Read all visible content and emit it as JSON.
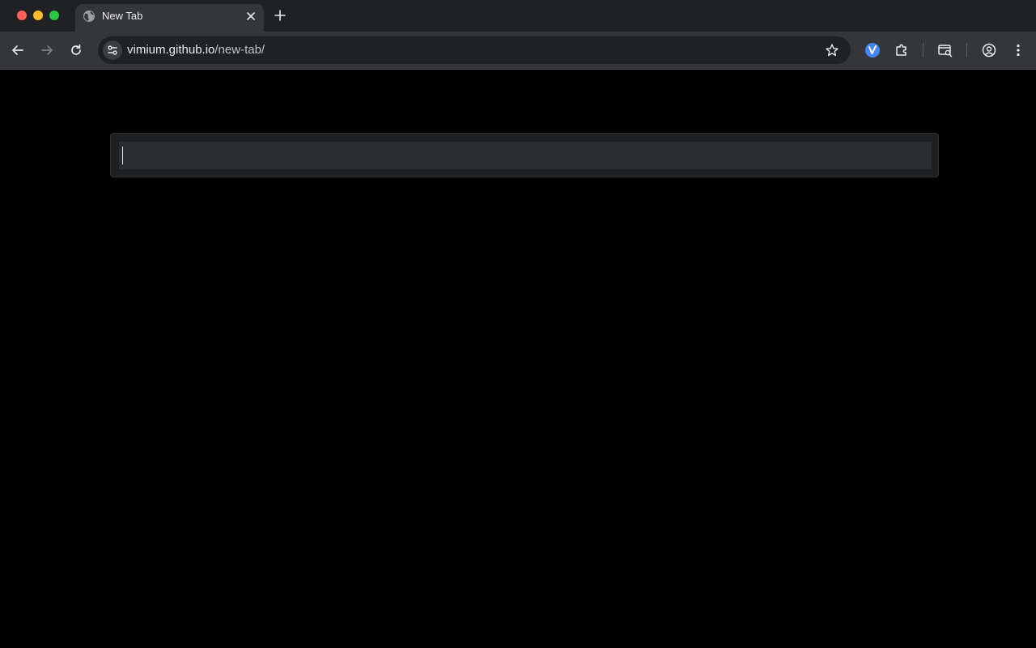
{
  "browser": {
    "tab": {
      "title": "New Tab"
    },
    "omnibox": {
      "url_host": "vimium.github.io",
      "url_path": "/new-tab/"
    },
    "icons": {
      "favicon": "globe-icon",
      "tab_close": "close-icon",
      "new_tab": "plus-icon",
      "back": "arrow-left-icon",
      "forward": "arrow-right-icon",
      "reload": "reload-icon",
      "site_info": "tune-icon",
      "bookmark": "star-icon",
      "vimium": "vimium-icon",
      "extensions": "puzzle-icon",
      "tab_search": "tab-search-icon",
      "profile": "profile-icon",
      "menu": "kebab-menu-icon"
    }
  },
  "page": {
    "search": {
      "value": "",
      "placeholder": ""
    }
  },
  "colors": {
    "page_background": "#000000",
    "tabstrip": "#202124",
    "toolbar": "#35363a",
    "omnibox": "#202124",
    "search_panel": "#1f2022",
    "search_input": "#2b2c2f",
    "vimium_accent": "#4285f4"
  }
}
